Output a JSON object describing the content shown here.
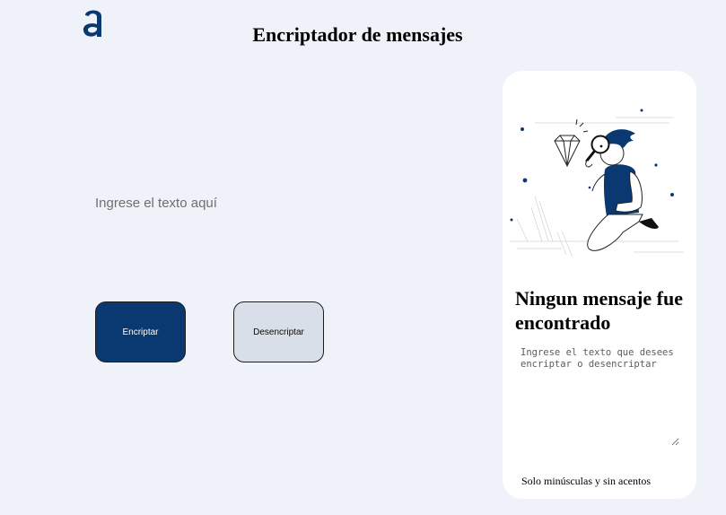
{
  "header": {
    "logo_icon": "alura-a-logo",
    "title": "Encriptador de mensajes"
  },
  "main": {
    "input_placeholder": "Ingrese el texto aquí",
    "input_value": "",
    "encrypt_label": "Encriptar",
    "decrypt_label": "Desencriptar"
  },
  "panel": {
    "illustration_icon": "person-searching-diamond-illustration",
    "title": "Ningun mensaje fue encontrado",
    "output_placeholder": "Ingrese el texto que desees encriptar o desencriptar",
    "hint": "Solo minúsculas y sin acentos"
  },
  "colors": {
    "background": "#eff2f8",
    "primary": "#0a3871",
    "secondary": "#d8dfe8",
    "panel": "#ffffff"
  }
}
